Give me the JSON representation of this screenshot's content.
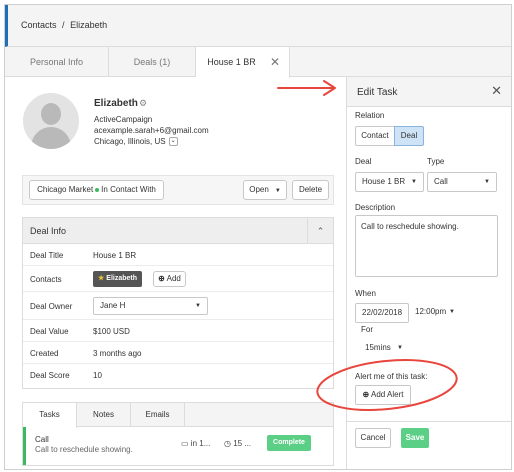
{
  "breadcrumb": {
    "root": "Contacts",
    "separator": "/",
    "current": "Elizabeth"
  },
  "tabs": [
    {
      "label": "Personal Info"
    },
    {
      "label": "Deals (1)"
    },
    {
      "label": "House 1 BR"
    }
  ],
  "tab_close_glyph": "✕",
  "profile": {
    "name": "Elizabeth",
    "org": "ActiveCampaign",
    "email": "acexample.sarah+6@gmail.com",
    "location": "Chicago, Illinois, US"
  },
  "status": {
    "pipeline": "Chicago Market",
    "stage": "In Contact With",
    "status_value": "Open",
    "delete_label": "Delete"
  },
  "deal_info": {
    "header": "Deal Info",
    "rows": {
      "title": {
        "label": "Deal Title",
        "value": "House 1 BR"
      },
      "contacts": {
        "label": "Contacts",
        "chip": "Elizabeth",
        "add_label": "Add"
      },
      "owner": {
        "label": "Deal Owner",
        "value": "Jane H"
      },
      "value": {
        "label": "Deal Value",
        "value": "$100 USD"
      },
      "created": {
        "label": "Created",
        "value": "3 months ago"
      },
      "score": {
        "label": "Deal Score",
        "value": "10"
      }
    }
  },
  "bottom_tabs": [
    {
      "label": "Tasks"
    },
    {
      "label": "Notes"
    },
    {
      "label": "Emails"
    }
  ],
  "task": {
    "title": "Call",
    "description": "Call to reschedule showing.",
    "due": "in 1...",
    "duration": "15 ...",
    "complete_label": "Complete"
  },
  "edit_task": {
    "title": "Edit Task",
    "relation_label": "Relation",
    "relation_options": [
      "Contact",
      "Deal"
    ],
    "relation_selected": "Deal",
    "deal_label": "Deal",
    "deal_value": "House 1 BR",
    "type_label": "Type",
    "type_value": "Call",
    "description_label": "Description",
    "description_value": "Call to reschedule showing.",
    "when_label": "When",
    "date_value": "22/02/2018",
    "time_value": "12:00pm",
    "for_label": "For",
    "duration_value": "15mins",
    "alert_label": "Alert me of this task:",
    "add_alert_label": "Add Alert",
    "cancel_label": "Cancel",
    "save_label": "Save"
  },
  "colors": {
    "accent_blue": "#1e6fb8",
    "green": "#5ccf86",
    "annotation_red": "#e8453c",
    "segment_active": "#cfe3f7"
  },
  "icons": {
    "gear": "gear-icon",
    "star": "star-icon",
    "plus": "plus-icon",
    "calendar": "calendar-icon",
    "clock": "clock-icon",
    "close": "close-icon",
    "chevron": "chevron-down-icon"
  }
}
